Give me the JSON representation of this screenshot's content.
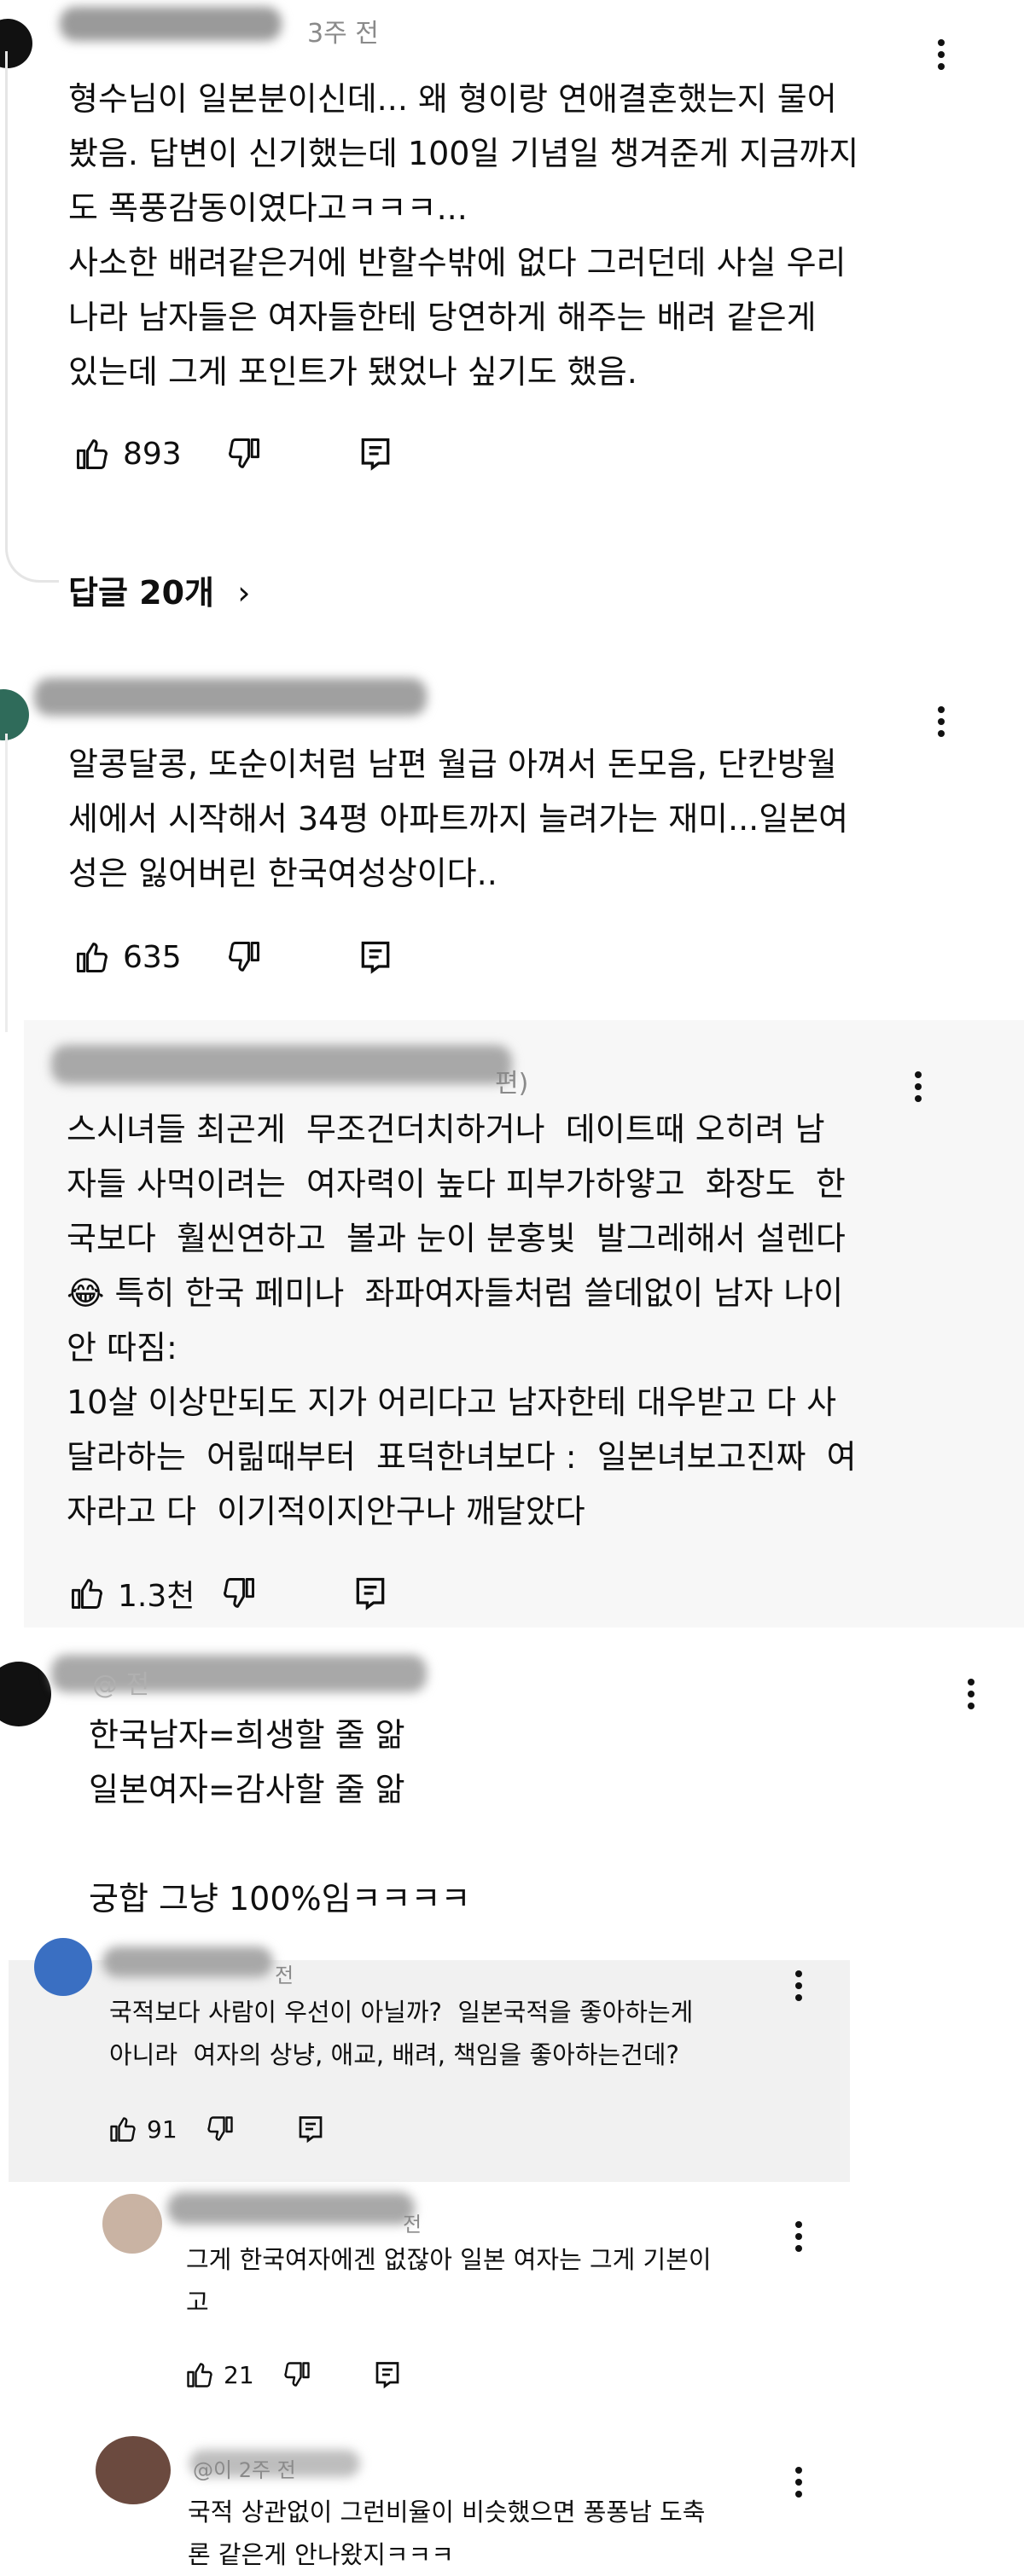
{
  "comments": [
    {
      "meta": "3주 전",
      "body": "형수님이 일본분이신데... 왜 형이랑 연애결혼했는지 물어\n봤음. 답변이 신기했는데 100일 기념일 챙겨준게 지금까지\n도 폭풍감동이였다고ㅋㅋㅋ...\n사소한 배려같은거에 반할수밖에 없다 그러던데 사실 우리\n나라 남자들은 여자들한테 당연하게 해주는 배려 같은게\n있는데 그게 포인트가 됐었나 싶기도 했음.",
      "likes": "893",
      "replies": "답글 20개"
    },
    {
      "body": "알콩달콩, 또순이처럼 남편 월급 아껴서 돈모음, 단칸방월\n세에서 시작해서 34평 아파트까지 늘려가는 재미...일본여\n성은 잃어버린 한국여성상이다..",
      "likes": "635"
    },
    {
      "meta": "편)",
      "body": "스시녀들 최곤게  무조건더치하거나  데이트때 오히려 남\n자들 사먹이려는  여자력이 높다 피부가하얗고  화장도  한\n국보다  훨씬연하고  볼과 눈이 분홍빛  발그레해서 설렌다\n😂 특히 한국 페미나  좌파여자들처럼 쓸데없이 남자 나이\n안 따짐:\n10살 이상만되도 지가 어리다고 남자한테 대우받고 다 사\n달라하는  어릶때부터  표덕한녀보다 :  일본녀보고진짜  여\n자라고 다  이기적이지안구나 깨달았다",
      "likes": "1.3천"
    },
    {
      "meta": "@ 전",
      "body": "한국남자=희생할 줄 앎\n일본여자=감사할 줄 앎\n\n궁합 그냥 100%임ㅋㅋㅋㅋ"
    },
    {
      "meta": "전",
      "body": "국적보다 사람이 우선이 아닐까?  일본국적을 좋아하는게\n아니라  여자의 상냥, 애교, 배려, 책임을 좋아하는건데?",
      "likes": "91"
    },
    {
      "meta": "전",
      "body": "그게 한국여자에겐 없잖아 일본 여자는 그게 기본이\n고",
      "likes": "21"
    },
    {
      "meta": "@이 2주 전",
      "body": "국적 상관없이 그런비율이 비슷했으면 퐁퐁남 도축\n론 같은게 안나왔지ㅋㅋㅋ"
    }
  ]
}
